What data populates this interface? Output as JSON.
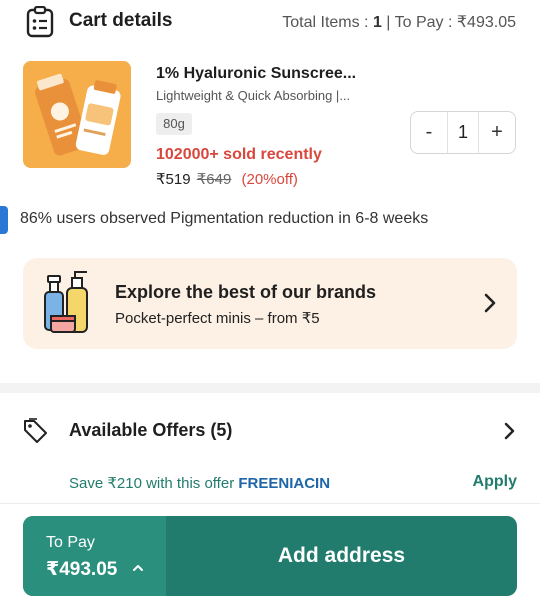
{
  "header": {
    "title": "Cart details",
    "items_label": "Total Items : ",
    "items_count": "1",
    "separator": " | ",
    "pay_label": "To Pay : ",
    "pay_amount": "₹493.05"
  },
  "product": {
    "title": "1% Hyaluronic Sunscree...",
    "subtitle": "Lightweight & Quick Absorbing |...",
    "size": "80g",
    "sold": "102000+ sold recently",
    "price": "₹519",
    "mrp": "₹649",
    "discount": "(20%off)",
    "quantity": "1",
    "minus_label": "-",
    "plus_label": "+"
  },
  "info": {
    "text": "86% users observed Pigmentation reduction in 6-8 weeks",
    "accent": "#2b78d4"
  },
  "brand_card": {
    "title": "Explore the best of our brands",
    "subtitle": "Pocket-perfect minis – from ₹5",
    "background": "#fdf0e4"
  },
  "offers": {
    "title": "Available Offers (5)",
    "offer_text": "Save ₹210 with this offer ",
    "offer_code": "FREENIACIN",
    "apply_label": "Apply"
  },
  "footer": {
    "topay_label": "To Pay",
    "topay_amount": "₹493.05",
    "cta_label": "Add address",
    "accent": "#217c6d"
  },
  "icons": {
    "cart": "clipboard-list-icon",
    "brand": "cosmetics-bottles-icon",
    "chevron": "chevron-right-icon",
    "tag": "tag-icon",
    "caret": "chevron-up-icon"
  }
}
